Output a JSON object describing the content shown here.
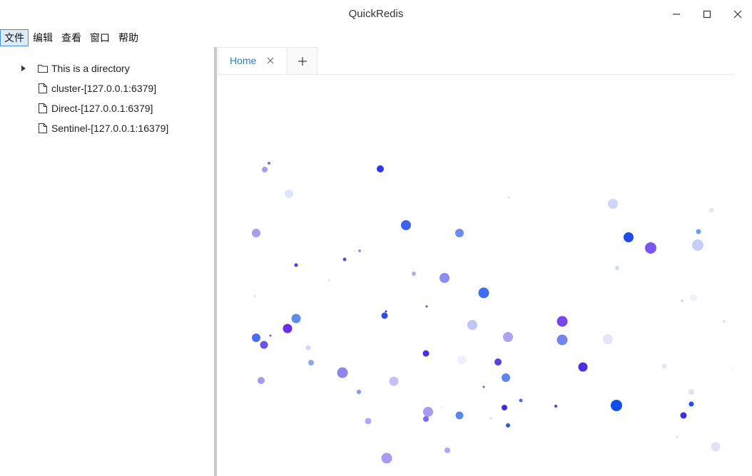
{
  "window": {
    "title": "QuickRedis"
  },
  "menu": {
    "items": [
      "文件",
      "编辑",
      "查看",
      "窗口",
      "帮助"
    ],
    "active_index": 0
  },
  "tree": {
    "items": [
      {
        "label": "This is a directory",
        "type": "folder",
        "expandable": true
      },
      {
        "label": "cluster-[127.0.0.1:6379]",
        "type": "file"
      },
      {
        "label": "Direct-[127.0.0.1:6379]",
        "type": "file"
      },
      {
        "label": "Sentinel-[127.0.0.1:16379]",
        "type": "file"
      }
    ]
  },
  "tabs": [
    {
      "label": "Home",
      "active": true
    }
  ],
  "colors": {
    "tab_active_text": "#1a84e6",
    "menu_active_bg": "#dcebf7",
    "menu_active_border": "#4a90d9",
    "splitter": "#c8c8c8"
  }
}
